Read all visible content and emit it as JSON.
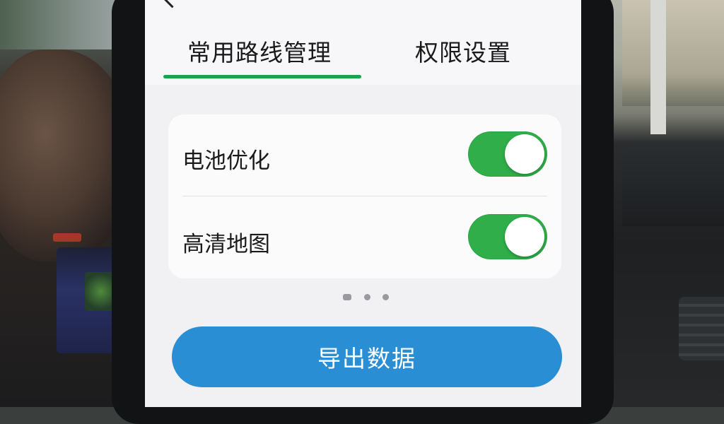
{
  "tabs": [
    {
      "label": "常用路线管理",
      "active": true
    },
    {
      "label": "权限设置",
      "active": false
    }
  ],
  "settings": [
    {
      "label": "电池优化",
      "enabled": true
    },
    {
      "label": "高清地图",
      "enabled": true
    }
  ],
  "pager": {
    "pages": 3,
    "current": 1
  },
  "actions": {
    "export_label": "导出数据"
  },
  "colors": {
    "accent_green": "#1aa34a",
    "toggle_on": "#2fae4a",
    "button_blue": "#2a8ed4"
  }
}
